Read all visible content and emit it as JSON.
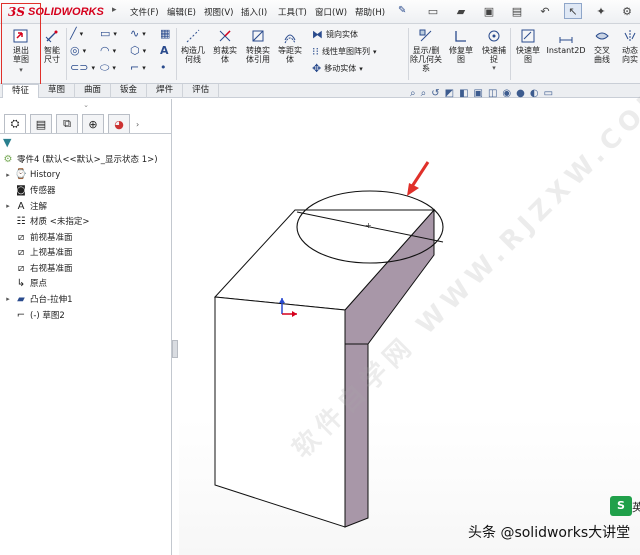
{
  "app": {
    "brand_ds": "3S",
    "brand_name": "SOLIDWORKS"
  },
  "menu": [
    "文件(F)",
    "编辑(E)",
    "视图(V)",
    "插入(I)",
    "工具(T)",
    "窗口(W)",
    "帮助(H)"
  ],
  "ribbon": {
    "exit_sketch": "退出草图",
    "smart_dim": "智能尺寸",
    "construction": "构造几何线",
    "trim": "剪裁实体",
    "convert": "转换实体引用",
    "offset": "等距实体",
    "mirror": "镜向实体",
    "linear_pattern": "线性草图阵列",
    "move": "移动实体",
    "display_delete": "显示/删除几何关系",
    "repair": "修复草图",
    "quick_snap": "快速捕捉",
    "rapid_sketch": "快速草图",
    "instant2d": "Instant2D",
    "intersection": "交叉曲线",
    "dynamic_mirror": "动态向实"
  },
  "tabs": [
    "特征",
    "草图",
    "曲面",
    "钣金",
    "焊件",
    "评估"
  ],
  "active_tab": "特征",
  "tree": {
    "root": "零件4 (默认<<默认>_显示状态 1>)",
    "items": [
      {
        "label": "History",
        "icon": "history-icon",
        "expand": "▸"
      },
      {
        "label": "传感器",
        "icon": "sensor-icon",
        "expand": ""
      },
      {
        "label": "注解",
        "icon": "annotation-icon",
        "expand": "▸"
      },
      {
        "label": "材质 <未指定>",
        "icon": "material-icon",
        "expand": ""
      },
      {
        "label": "前视基准面",
        "icon": "plane-icon",
        "expand": ""
      },
      {
        "label": "上视基准面",
        "icon": "plane-icon",
        "expand": ""
      },
      {
        "label": "右视基准面",
        "icon": "plane-icon",
        "expand": ""
      },
      {
        "label": "原点",
        "icon": "origin-icon",
        "expand": ""
      },
      {
        "label": "凸台-拉伸1",
        "icon": "extrude-icon",
        "expand": "▸"
      },
      {
        "label": "(-) 草图2",
        "icon": "sketch-icon",
        "expand": ""
      }
    ]
  },
  "viewport": {
    "watermark": "软件自学网 WWW.RJZXW.COM",
    "footer_text": "头条 @solidworks大讲堂",
    "badge": "S",
    "badge_text": "英"
  },
  "colors": {
    "accent_red": "#e0302a",
    "brand_red": "#d5001c",
    "face_shade": "#a897a8"
  }
}
